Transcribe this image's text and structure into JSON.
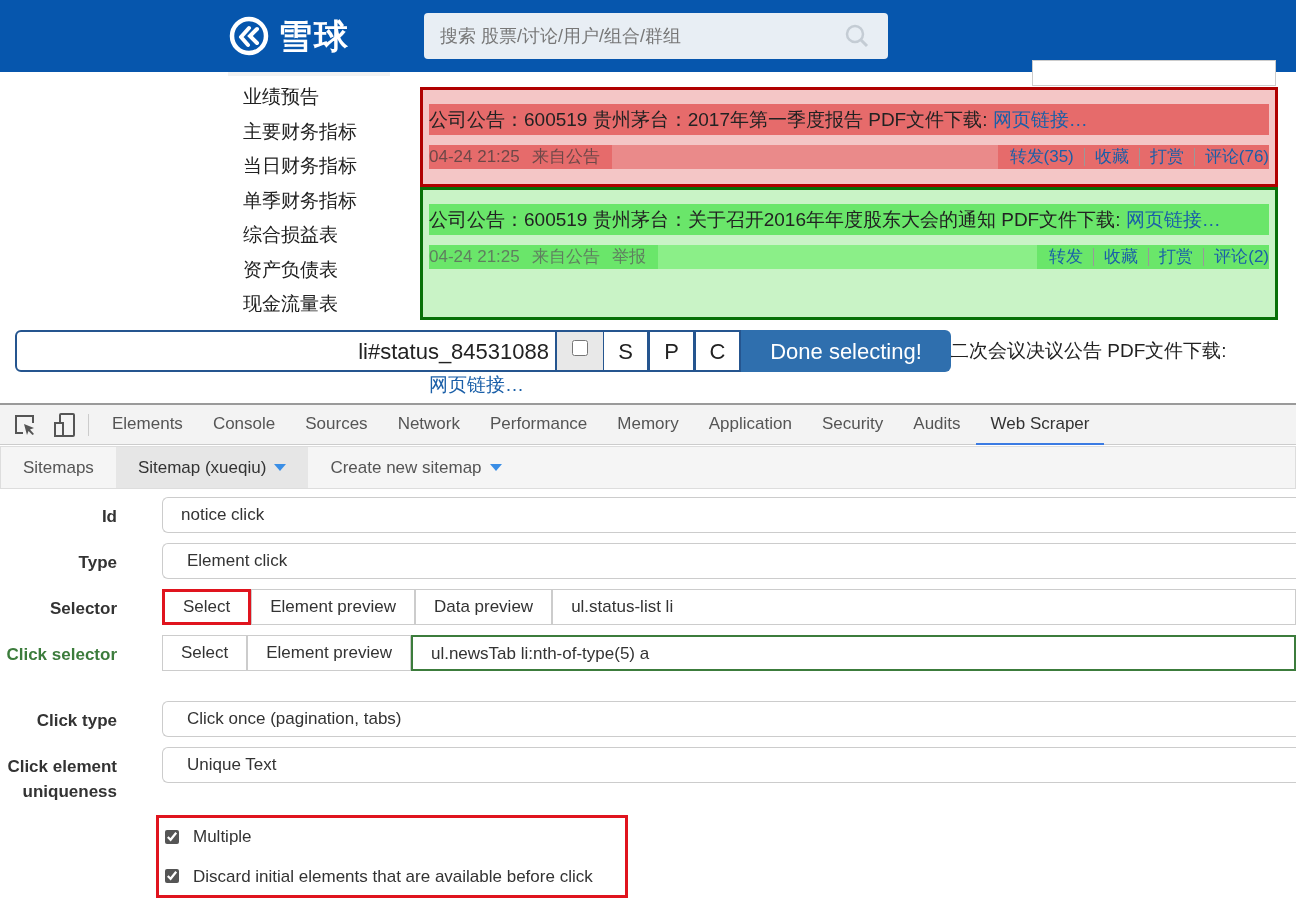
{
  "header": {
    "logo_text": "雪球",
    "search_placeholder": "搜索 股票/讨论/用户/组合/群组"
  },
  "side_menu": {
    "items": [
      "业绩预告",
      "主要财务指标",
      "当日财务指标",
      "单季财务指标",
      "综合损益表",
      "资产负债表",
      "现金流量表"
    ]
  },
  "posts": [
    {
      "kind": "selected",
      "title": "公司公告：600519 贵州茅台：2017年第一季度报告 PDF文件下载: ",
      "link": "网页链接…",
      "time": "04-24 21:25",
      "source": "来自公告",
      "actions": [
        "转发(35)",
        "收藏",
        "打赏",
        "评论(76)"
      ]
    },
    {
      "kind": "hovered",
      "title": "公司公告：600519 贵州茅台：关于召开2016年年度股东大会的通知 PDF文件下载: ",
      "link": "网页链接…",
      "time": "04-24 21:25",
      "source": "来自公告",
      "report": "举报",
      "actions": [
        "转发",
        "收藏",
        "打赏",
        "评论(2)"
      ]
    },
    {
      "kind": "plain",
      "title": "二次会议决议公告 PDF文件下载:",
      "link": "网页链接…"
    }
  ],
  "selector_toolbar": {
    "value": "li#status_84531088",
    "checked": false,
    "buttons": [
      "S",
      "P",
      "C"
    ],
    "done": "Done selecting!"
  },
  "devtools_tabs": [
    {
      "label": "Elements",
      "selected": false
    },
    {
      "label": "Console",
      "selected": false
    },
    {
      "label": "Sources",
      "selected": false
    },
    {
      "label": "Network",
      "selected": false
    },
    {
      "label": "Performance",
      "selected": false
    },
    {
      "label": "Memory",
      "selected": false
    },
    {
      "label": "Application",
      "selected": false
    },
    {
      "label": "Security",
      "selected": false
    },
    {
      "label": "Audits",
      "selected": false
    },
    {
      "label": "Web Scraper",
      "selected": true
    }
  ],
  "scraper_nav": [
    {
      "label": "Sitemaps",
      "dropdown": false,
      "selected": false
    },
    {
      "label": "Sitemap (xueqiu)",
      "dropdown": true,
      "selected": true
    },
    {
      "label": "Create new sitemap",
      "dropdown": true,
      "selected": false
    }
  ],
  "form": [
    {
      "kind": "input",
      "label": "Id",
      "value": "notice click",
      "valid": false
    },
    {
      "kind": "select",
      "label": "Type",
      "value": "Element click",
      "valid": false
    },
    {
      "kind": "selector",
      "label": "Selector",
      "value": "ul.status-list li",
      "valid": false,
      "buttons": [
        {
          "label": "Select",
          "outlined": true
        },
        {
          "label": "Element preview",
          "outlined": false
        },
        {
          "label": "Data preview",
          "outlined": false
        }
      ]
    },
    {
      "kind": "selector",
      "label": "Click selector",
      "value": "ul.newsTab li:nth-of-type(5) a",
      "valid": true,
      "buttons": [
        {
          "label": "Select",
          "outlined": false
        },
        {
          "label": "Element preview",
          "outlined": false
        }
      ]
    },
    {
      "kind": "select",
      "label": "Click type",
      "value": "Click once (pagination, tabs)",
      "valid": false
    },
    {
      "kind": "select",
      "label": "Click element uniqueness",
      "value": "Unique Text",
      "valid": false
    }
  ],
  "options": {
    "outlined": true,
    "items": [
      {
        "label": "Multiple",
        "checked": true
      },
      {
        "label": "Discard initial elements that are available before click",
        "checked": true
      }
    ]
  }
}
